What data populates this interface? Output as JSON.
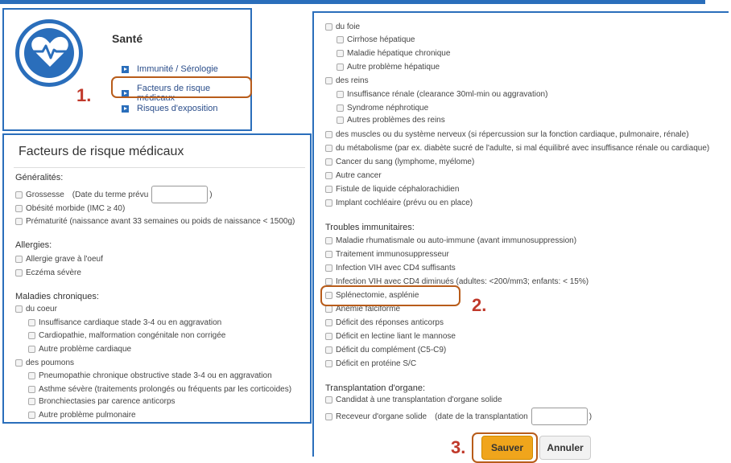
{
  "header": {
    "title": "Santé"
  },
  "nav": [
    {
      "label": "Immunité / Sérologie"
    },
    {
      "label": "Facteurs de risque médicaux"
    },
    {
      "label": "Risques d'exposition"
    }
  ],
  "steps": {
    "one": "1.",
    "two": "2.",
    "three": "3."
  },
  "form": {
    "title": "Facteurs de risque médicaux",
    "generalites": "Généralités:",
    "grossesse": "Grossesse",
    "grossesse_date_label": "(Date du terme prévu",
    "grossesse_date_value": "",
    "close_paren": ")",
    "obesite": "Obésité morbide (IMC ≥ 40)",
    "prematurite": "Prématurité (naissance avant 33 semaines ou poids de naissance < 1500g)",
    "allergies": "Allergies:",
    "allergie_oeuf": "Allergie grave à l'oeuf",
    "eczema": "Eczéma sévère",
    "maladies_chroniques": "Maladies chroniques:",
    "du_coeur": "du coeur",
    "insuff_cardiaque": "Insuffisance cardiaque stade 3-4 ou en aggravation",
    "cardiopathie": "Cardiopathie, malformation congénitale non corrigée",
    "autre_cardiaque": "Autre problème cardiaque",
    "des_poumons": "des poumons",
    "pneumopathie": "Pneumopathie chronique obstructive stade 3-4 ou en aggravation",
    "asthme": "Asthme sévère (traitements prolongés ou fréquents par les corticoides)",
    "bronchiectasies": "Bronchiectasies par carence anticorps",
    "autre_pulmonaire": "Autre problème pulmonaire"
  },
  "right": {
    "du_foie": "du foie",
    "cirrhose": "Cirrhose hépatique",
    "maladie_hepatique": "Maladie hépatique chronique",
    "autre_hepatique": "Autre problème hépatique",
    "des_reins": "des reins",
    "insuff_renale": "Insuffisance rénale (clearance 30ml-min ou aggravation)",
    "syndrome_nephrotique": "Syndrome néphrotique",
    "autres_reins": "Autres problèmes des reins",
    "muscles": "des muscles ou du système nerveux (si répercussion sur la fonction cardiaque, pulmonaire, rénale)",
    "metabolisme": "du métabolisme (par ex. diabète sucré de l'adulte, si mal équilibré avec insuffisance rénale ou cardiaque)",
    "cancer_sang": "Cancer du sang (lymphome, myélome)",
    "autre_cancer": "Autre cancer",
    "fistule": "Fistule de liquide céphalorachidien",
    "implant": "Implant cochléaire (prévu ou en place)",
    "troubles": "Troubles immunitaires:",
    "rhumatismale": "Maladie rhumatismale ou auto-immune (avant immunosuppression)",
    "traitement": "Traitement immunosuppresseur",
    "vih_suffisants": "Infection VIH avec CD4 suffisants",
    "vih_diminues": "Infection VIH avec CD4 diminués (adultes: <200/mm3; enfants: < 15%)",
    "splenectomie": "Splénectomie, asplénie",
    "anemie": "Anémie falciforme",
    "deficit_anticorps": "Déficit des réponses anticorps",
    "deficit_lectine": "Déficit en lectine liant le mannose",
    "deficit_complement": "Déficit du complément (C5-C9)",
    "deficit_proteine": "Déficit en protéine S/C",
    "transplantation": "Transplantation d'organe:",
    "candidat": "Candidat à une transplantation d'organe solide",
    "receveur": "Receveur d'organe solide",
    "receveur_date_label": "(date de la transplantation",
    "receveur_date_value": "",
    "close_paren": ")",
    "save": "Sauver",
    "cancel": "Annuler"
  },
  "colors": {
    "accent": "#2a6ebb",
    "highlight": "#b85c1a",
    "step_number": "#c0392b",
    "save_button": "#f0a51c"
  },
  "icons": {
    "logo": "heart-pulse-icon",
    "nav": "play-square-icon"
  }
}
